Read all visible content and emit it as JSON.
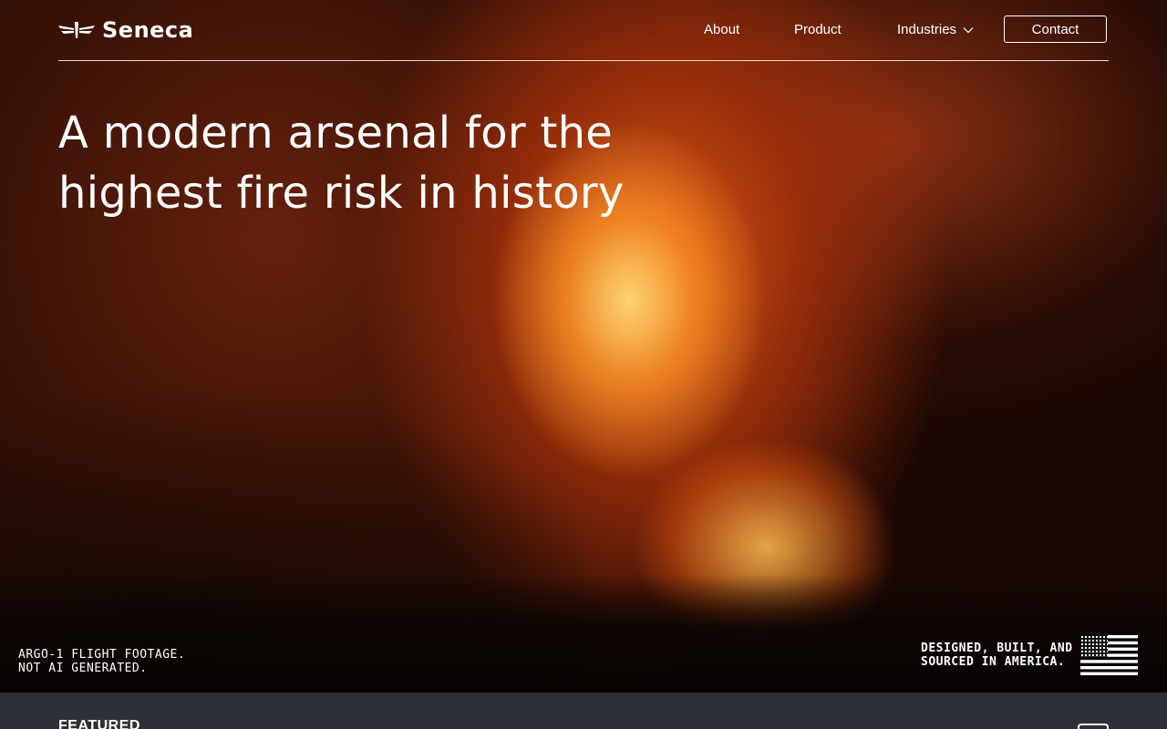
{
  "brand": {
    "name": "Seneca",
    "logo_icon": "seneca-wing-logo-icon"
  },
  "nav": {
    "about": "About",
    "product": "Product",
    "industries": "Industries",
    "industries_icon": "chevron-down-icon",
    "contact": "Contact"
  },
  "hero": {
    "headline_line1": "A modern arsenal for the",
    "headline_line2": "highest fire risk in history",
    "footage_note_line1": "ARGO-1 FLIGHT FOOTAGE.",
    "footage_note_line2": "NOT AI GENERATED.",
    "america_line1": "DESIGNED, BUILT, AND",
    "america_line2": "SOURCED IN AMERICA.",
    "america_icon": "us-flag-icon"
  },
  "featured": {
    "label": "FEATURED"
  },
  "colors": {
    "accent_fire": "#e8541a",
    "bar_background": "#2c3138",
    "text": "#ffffff"
  }
}
